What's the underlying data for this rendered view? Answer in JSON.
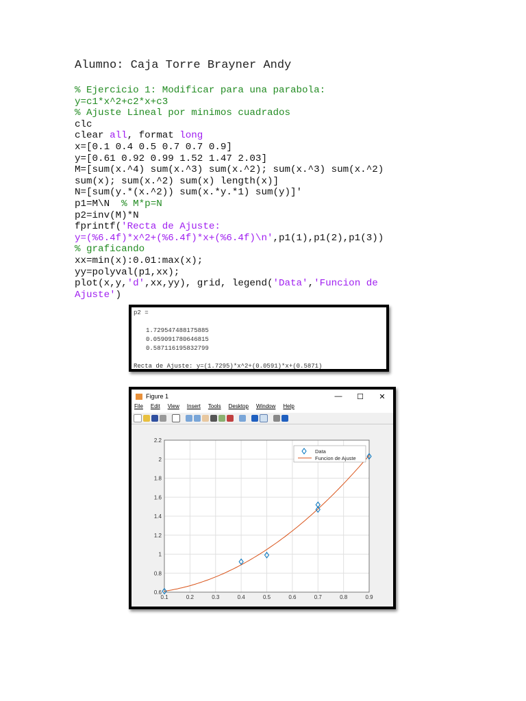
{
  "student": "Alumno: Caja Torre Brayner Andy",
  "code_lines": [
    [
      {
        "t": "% Ejercicio 1: Modificar para una parabola:",
        "c": "c"
      }
    ],
    [
      {
        "t": "y=c1*x^2+c2*x+c3",
        "c": "c"
      }
    ],
    [
      {
        "t": "% Ajuste Lineal por minimos cuadrados",
        "c": "c"
      }
    ],
    [
      {
        "t": "clc",
        "c": ""
      }
    ],
    [
      {
        "t": "clear ",
        "c": ""
      },
      {
        "t": "all",
        "c": "k"
      },
      {
        "t": ", format ",
        "c": ""
      },
      {
        "t": "long",
        "c": "k"
      }
    ],
    [
      {
        "t": "x=[0.1 0.4 0.5 0.7 0.7 0.9]",
        "c": ""
      }
    ],
    [
      {
        "t": "y=[0.61 0.92 0.99 1.52 1.47 2.03]",
        "c": ""
      }
    ],
    [
      {
        "t": "M=[sum(x.^4) sum(x.^3) sum(x.^2); sum(x.^3) sum(x.^2)",
        "c": ""
      }
    ],
    [
      {
        "t": "sum(x); sum(x.^2) sum(x) length(x)]",
        "c": ""
      }
    ],
    [
      {
        "t": "N=[sum(y.*(x.^2)) sum(x.*y.*1) sum(y)]'",
        "c": ""
      }
    ],
    [
      {
        "t": "p1=M\\N  ",
        "c": ""
      },
      {
        "t": "% M*p=N",
        "c": "c"
      }
    ],
    [
      {
        "t": "p2=inv(M)*N",
        "c": ""
      }
    ],
    [
      {
        "t": "fprintf(",
        "c": ""
      },
      {
        "t": "'Recta de Ajuste:",
        "c": "s"
      }
    ],
    [
      {
        "t": "y=(%6.4f)*x^2+(%6.4f)*x+(%6.4f)\\n'",
        "c": "s"
      },
      {
        "t": ",p1(1),p1(2),p1(3))",
        "c": ""
      }
    ],
    [
      {
        "t": "% graficando",
        "c": "c"
      }
    ],
    [
      {
        "t": "xx=min(x):0.01:max(x);",
        "c": ""
      }
    ],
    [
      {
        "t": "yy=polyval(p1,xx);",
        "c": ""
      }
    ],
    [
      {
        "t": "plot(x,y,",
        "c": ""
      },
      {
        "t": "'d'",
        "c": "s"
      },
      {
        "t": ",xx,yy), grid, legend(",
        "c": ""
      },
      {
        "t": "'Data'",
        "c": "s"
      },
      {
        "t": ",",
        "c": ""
      },
      {
        "t": "'Funcion de",
        "c": "s"
      }
    ],
    [
      {
        "t": "Ajuste'",
        "c": "s"
      },
      {
        "t": ")",
        "c": ""
      }
    ]
  ],
  "console": {
    "header": "p2 =",
    "values": [
      "1.729547488175885",
      "0.059091780646815",
      "0.587116195832799"
    ],
    "result": "Recta de Ajuste: y=(1.7295)*x^2+(0.0591)*x+(0.5871)"
  },
  "figure": {
    "title": "Figure 1",
    "menu": [
      "File",
      "Edit",
      "View",
      "Insert",
      "Tools",
      "Desktop",
      "Window",
      "Help"
    ],
    "win_buttons": [
      "—",
      "☐",
      "✕"
    ]
  },
  "chart_data": {
    "type": "scatter",
    "title": "",
    "xlabel": "",
    "ylabel": "",
    "xlim": [
      0.1,
      0.9
    ],
    "ylim": [
      0.6,
      2.2
    ],
    "xticks": [
      0.1,
      0.2,
      0.3,
      0.4,
      0.5,
      0.6,
      0.7,
      0.8,
      0.9
    ],
    "yticks": [
      0.6,
      0.8,
      1,
      1.2,
      1.4,
      1.6,
      1.8,
      2,
      2.2
    ],
    "grid": true,
    "legend_position": "top-right",
    "series": [
      {
        "name": "Data",
        "marker": "diamond",
        "color": "#0072bd",
        "x": [
          0.1,
          0.4,
          0.5,
          0.7,
          0.7,
          0.9
        ],
        "y": [
          0.61,
          0.92,
          0.99,
          1.52,
          1.47,
          2.03
        ]
      },
      {
        "name": "Funcion de Ajuste",
        "line": true,
        "color": "#d95319",
        "coeffs": [
          1.7295,
          0.0591,
          0.5871
        ]
      }
    ]
  }
}
